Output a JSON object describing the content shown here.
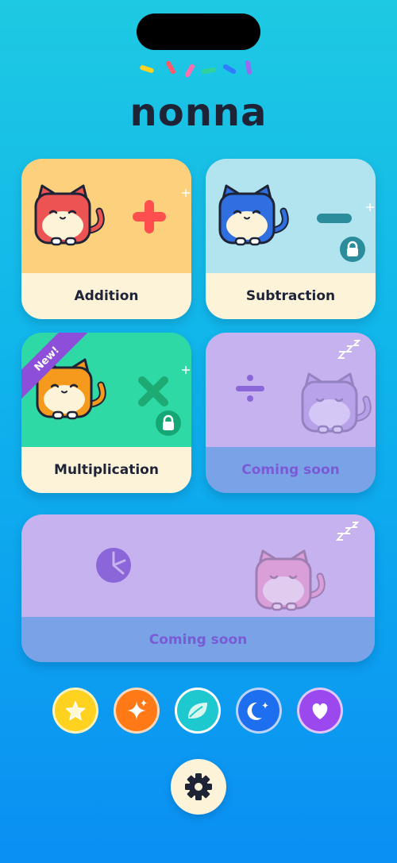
{
  "app": {
    "title": "nonna",
    "sprinkle_colors": [
      "#ffd21f",
      "#ff5a6a",
      "#ff6fae",
      "#33d29a",
      "#2f7dff",
      "#9b6af0"
    ]
  },
  "cards": [
    {
      "label": "Addition",
      "cat": "red-cat-icon",
      "operator": "plus-icon",
      "locked": false,
      "top_color": "#fdd07e"
    },
    {
      "label": "Subtraction",
      "cat": "blue-cat-icon",
      "operator": "minus-icon",
      "locked": true,
      "top_color": "#b2e4f0"
    },
    {
      "label": "Multiplication",
      "cat": "orange-cat-icon",
      "operator": "times-icon",
      "locked": true,
      "badge": "New!",
      "top_color": "#2ed9a6"
    },
    {
      "label": "Coming soon",
      "cat": "sleeping-purple-cat-icon",
      "operator": "divide-icon",
      "top_color": "#c5b2ee"
    },
    {
      "label": "Coming soon",
      "cat": "sleeping-pink-cat-icon",
      "operator": "pie-chart-icon",
      "top_color": "#c5b2ee"
    }
  ],
  "theme_badges": [
    {
      "name": "star",
      "color": "#ffd21f"
    },
    {
      "name": "sparkles",
      "color": "#ff7a16"
    },
    {
      "name": "leaf",
      "color": "#1ec8cf",
      "selected": true
    },
    {
      "name": "moon",
      "color": "#1e6ef0"
    },
    {
      "name": "heart",
      "color": "#9b48ef"
    }
  ],
  "settings": {
    "icon": "gear-icon"
  }
}
